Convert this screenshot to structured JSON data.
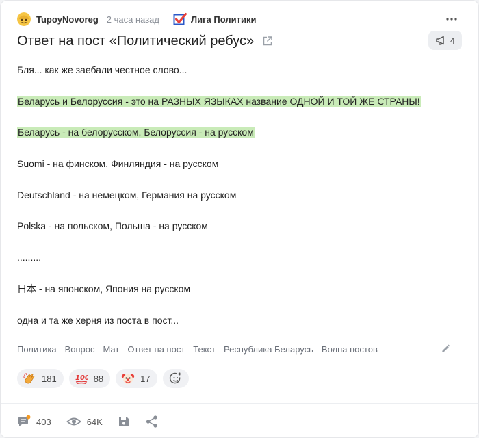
{
  "post": {
    "author": "TupoyNovoreg",
    "time": "2 часа назад",
    "community": "Лига Политики",
    "title": "Ответ на пост «Политический ребус»",
    "badge_count": "4"
  },
  "content": {
    "p1": "Бля... как же заебали честное слово...",
    "p2": "Беларусь и Белоруссия - это на РАЗНЫХ ЯЗЫКАХ название ОДНОЙ И ТОЙ ЖЕ СТРАНЫ!",
    "p3": "Беларусь - на белорусском, Белоруссия - на русском",
    "p4": "Suomi - на финском, Финляндия - на русском",
    "p5": "Deutschland - на немецком, Германия на русском",
    "p6": "Polska - на польском, Польша - на русском",
    "p7": ".........",
    "p8": "日本 - на японском, Япония на русском",
    "p9": "одна и та же херня из поста в пост..."
  },
  "tags": [
    "Политика",
    "Вопрос",
    "Мат",
    "Ответ на пост",
    "Текст",
    "Республика Беларусь",
    "Волна постов"
  ],
  "reactions": [
    {
      "icon": "clapping-hands-icon",
      "count": "181"
    },
    {
      "icon": "hundred-points-icon",
      "count": "88"
    },
    {
      "icon": "clown-face-icon",
      "count": "17"
    }
  ],
  "footer": {
    "comments": "403",
    "views": "64K"
  },
  "colors": {
    "highlight": "#c9ebb8",
    "accent_red": "#e8413b",
    "icon_gray": "#8a8f97"
  }
}
